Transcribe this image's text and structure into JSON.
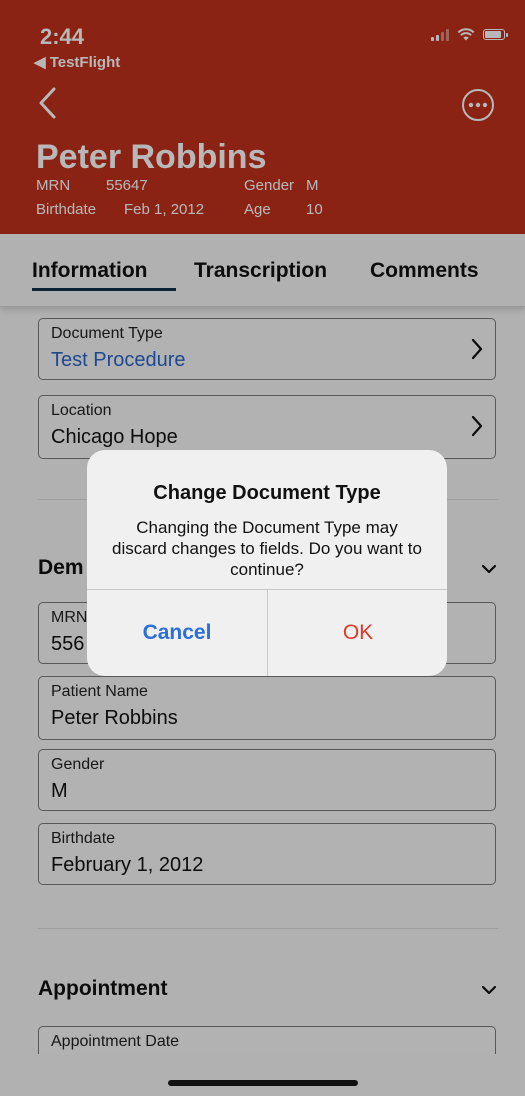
{
  "status_bar": {
    "time": "2:44",
    "back_app": "◀ TestFlight"
  },
  "header": {
    "patient_name": "Peter Robbins",
    "mrn_label": "MRN",
    "mrn_value": "55647",
    "gender_label": "Gender",
    "gender_value": "M",
    "birthdate_label": "Birthdate",
    "birthdate_value": "Feb 1, 2012",
    "age_label": "Age",
    "age_value": "10",
    "back_icon": "chevron-left-icon",
    "more_icon": "ellipsis-circle-icon"
  },
  "tabs": [
    {
      "label": "Information",
      "selected": true
    },
    {
      "label": "Transcription",
      "selected": false
    },
    {
      "label": "Comments",
      "selected": false
    }
  ],
  "content": {
    "document_type": {
      "label": "Document Type",
      "value": "Test Procedure"
    },
    "location": {
      "label": "Location",
      "value": "Chicago Hope"
    },
    "demographics": {
      "title": "Dem",
      "mrn_label": "MRN",
      "mrn_value": "556",
      "patient_name_label": "Patient Name",
      "patient_name_value": "Peter Robbins",
      "gender_label": "Gender",
      "gender_value": "M",
      "birthdate_label": "Birthdate",
      "birthdate_value": "February 1, 2012"
    },
    "appointment": {
      "title": "Appointment",
      "appointment_date_label": "Appointment Date"
    }
  },
  "alert": {
    "title": "Change Document Type",
    "message": "Changing the Document Type may discard changes to fields. Do you want to continue?",
    "cancel_label": "Cancel",
    "ok_label": "OK"
  },
  "colors": {
    "header_bg": "#c0311d",
    "link_blue": "#2a65c8",
    "cancel_blue": "#2a6fdb",
    "ok_red": "#e0392b",
    "tab_underline": "#12324d"
  }
}
